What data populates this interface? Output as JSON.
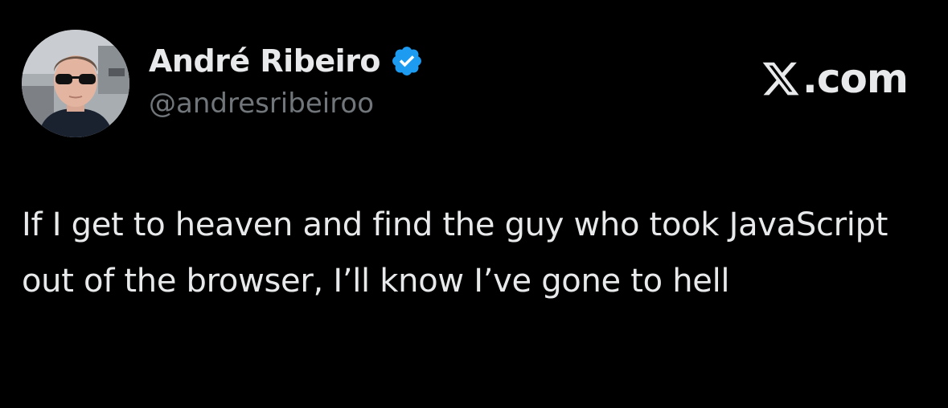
{
  "author": {
    "display_name": "André Ribeiro",
    "handle": "@andresribeiroo",
    "verified": true
  },
  "brand": {
    "logo_text": ".com",
    "logo_icon": "x-logo-icon"
  },
  "tweet": {
    "text": "If I get to heaven and find the guy who took JavaScript out of the browser, I’ll know I’ve gone to hell"
  },
  "colors": {
    "background": "#000000",
    "primary_text": "#e7e9ea",
    "secondary_text": "#71767b",
    "verified_blue": "#1d9bf0"
  },
  "icons": {
    "verified": "verified-badge-icon",
    "avatar": "profile-photo"
  }
}
